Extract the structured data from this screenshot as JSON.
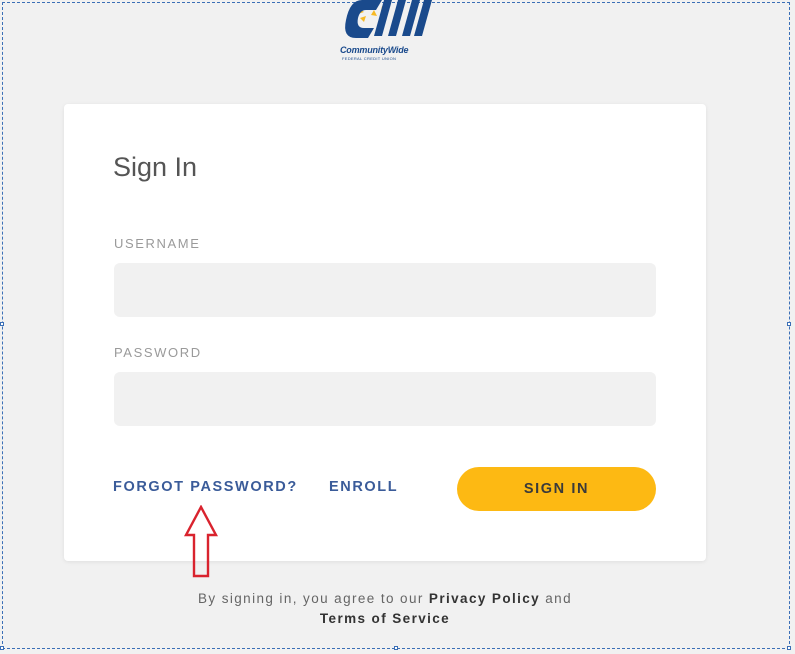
{
  "logo": {
    "name": "CommunityWide",
    "subtitle": "FEDERAL CREDIT UNION",
    "icon": "cwfcu-logo"
  },
  "card": {
    "title": "Sign In",
    "username": {
      "label": "USERNAME",
      "value": "",
      "placeholder": ""
    },
    "password": {
      "label": "PASSWORD",
      "value": "",
      "placeholder": ""
    },
    "forgot_password": "FORGOT PASSWORD?",
    "enroll": "ENROLL",
    "sign_in": "SIGN IN"
  },
  "footer": {
    "prefix": "By signing in, you agree to our",
    "privacy": "Privacy Policy",
    "and": "and",
    "terms": "Terms of Service"
  },
  "annotation": {
    "icon": "red-up-arrow-icon"
  },
  "colors": {
    "background": "#f1f1f1",
    "card": "#ffffff",
    "accent_button": "#fdb913",
    "link": "#3a5b99",
    "field_bg": "#f1f1f1",
    "annotation": "#d9232e"
  }
}
